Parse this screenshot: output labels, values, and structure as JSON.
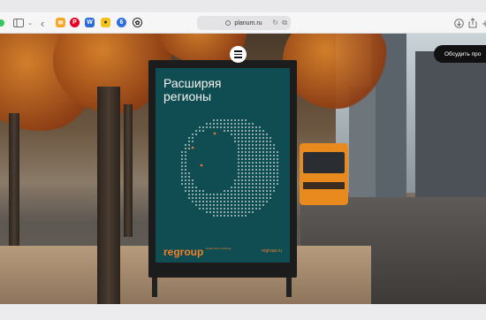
{
  "browser": {
    "address": "planum.ru",
    "icons": [
      "sidebar-icon",
      "chevron-down-icon",
      "back-icon",
      "download-icon",
      "share-icon",
      "add-tab-icon"
    ]
  },
  "page": {
    "discuss_button": "Обсудить про",
    "poster": {
      "title_line1": "Расширяя",
      "title_line2": "регионы",
      "brand": "regroup",
      "brand_tagline": "leadership consulting",
      "url": "regroup.ru"
    }
  },
  "colors": {
    "poster_bg": "#0f4d52",
    "brand": "#f07f2a",
    "button_bg": "#111111"
  }
}
